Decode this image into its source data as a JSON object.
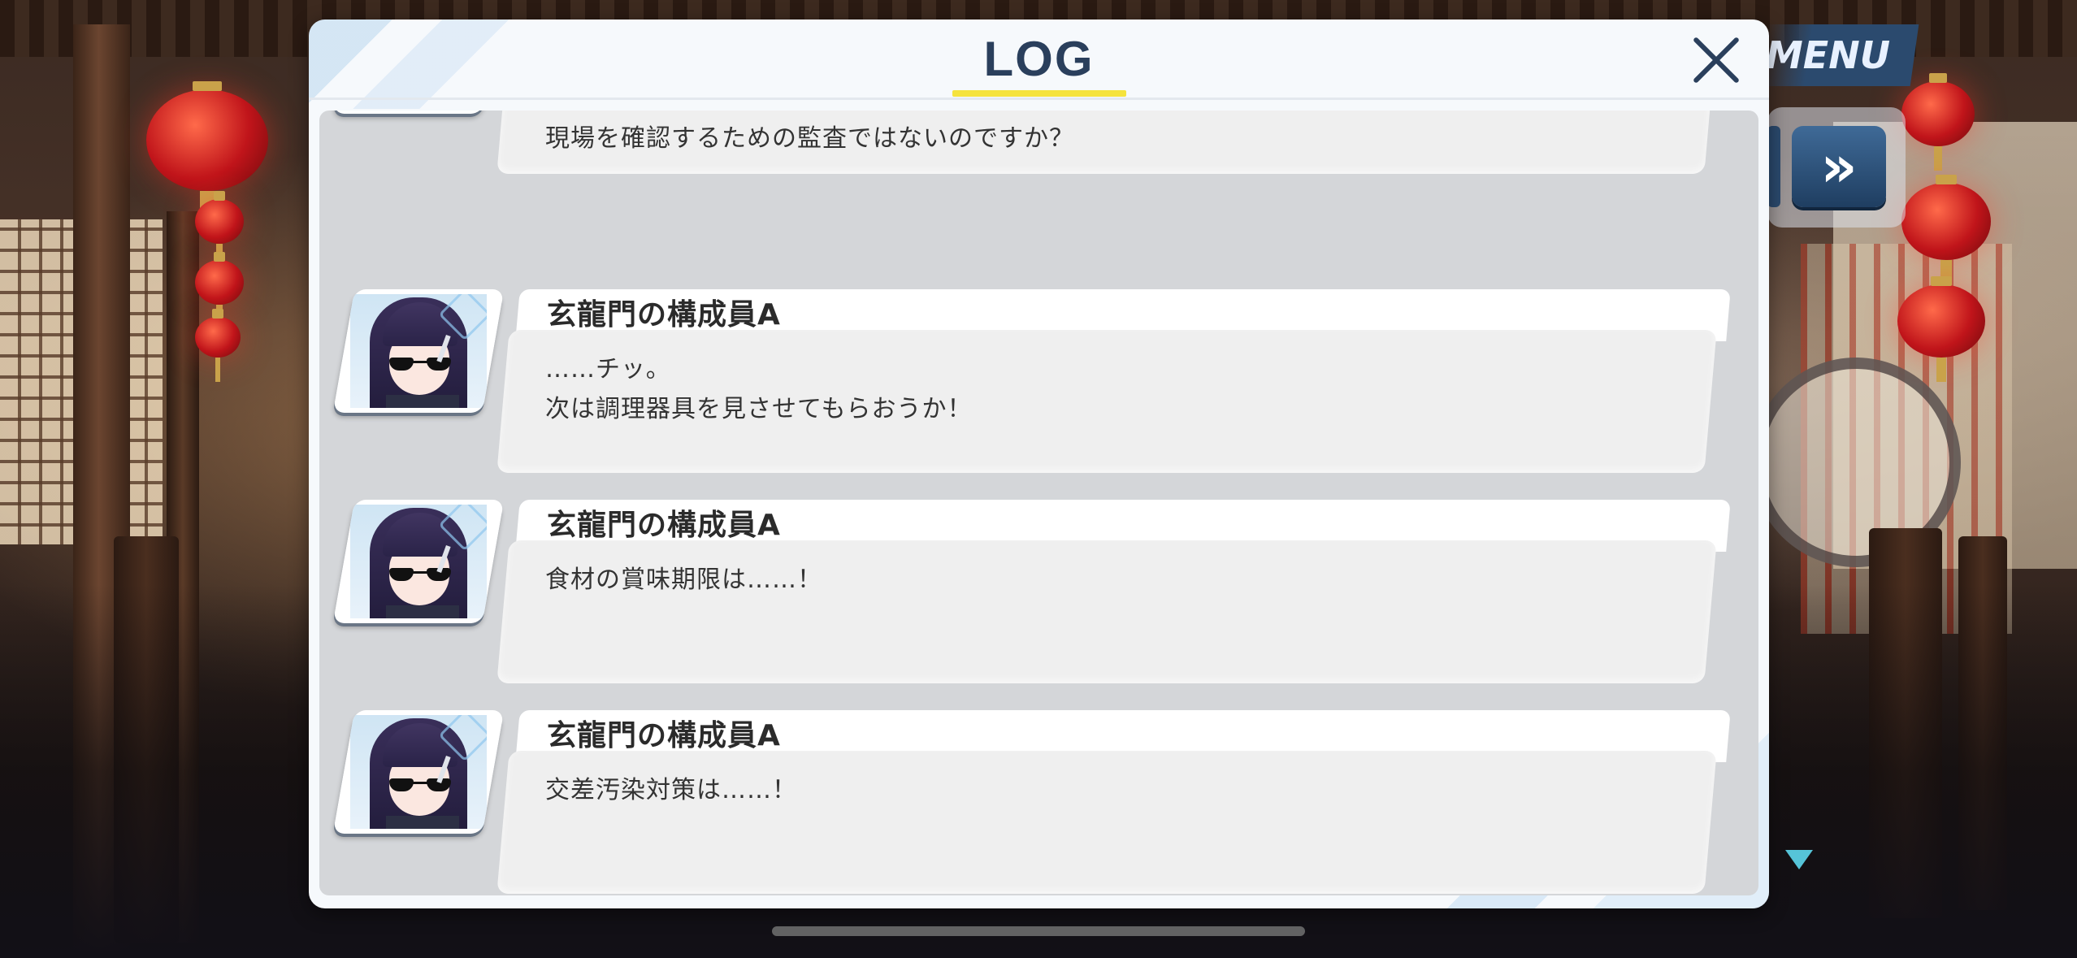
{
  "hud": {
    "menu_label": "MENU",
    "fast_forward_label": "»"
  },
  "log_modal": {
    "title": "LOG",
    "entries": [
      {
        "speaker": "",
        "portrait": "red-haired-student-portrait",
        "text": "現場を確認するための監査ではないのですか？"
      },
      {
        "speaker": "玄龍門の構成員A",
        "portrait": "sunglasses-member-portrait",
        "text": "……チッ。\n次は調理器具を見させてもらおうか！"
      },
      {
        "speaker": "玄龍門の構成員A",
        "portrait": "sunglasses-member-portrait",
        "text": "食材の賞味期限は……！"
      },
      {
        "speaker": "玄龍門の構成員A",
        "portrait": "sunglasses-member-portrait",
        "text": "交差汚染対策は……！"
      }
    ]
  },
  "colors": {
    "title_underline": "#f5e33d",
    "title_text": "#2a3f5c",
    "menu_button": "#2b4a6e",
    "next_indicator": "#56c4d8"
  }
}
